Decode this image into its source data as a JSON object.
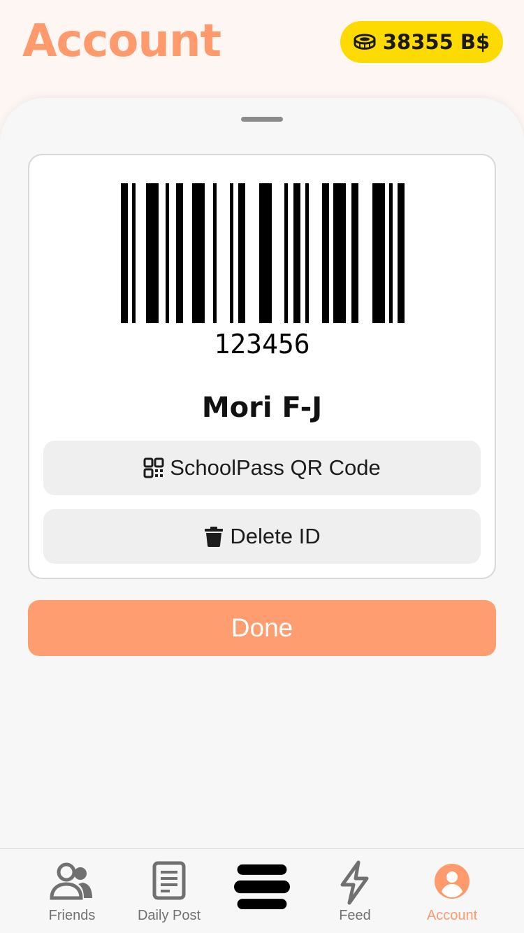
{
  "header": {
    "title": "Account",
    "balance": "38355 B$"
  },
  "id_card": {
    "barcode_number": "123456",
    "holder_name": "Mori F-J",
    "qr_button_label": "SchoolPass QR Code",
    "delete_button_label": "Delete ID"
  },
  "done_label": "Done",
  "tabbar": {
    "tabs": [
      {
        "label": "Friends",
        "icon": "friends-icon",
        "active": false
      },
      {
        "label": "Daily Post",
        "icon": "document-icon",
        "active": false
      },
      {
        "label": "",
        "icon": "home-logo-icon",
        "active": false
      },
      {
        "label": "Feed",
        "icon": "lightning-icon",
        "active": false
      },
      {
        "label": "Account",
        "icon": "user-circle-icon",
        "active": true
      }
    ]
  },
  "colors": {
    "accent": "#fe9a6c",
    "coin_badge": "#fedb00",
    "done_button": "#fe9d6f"
  }
}
